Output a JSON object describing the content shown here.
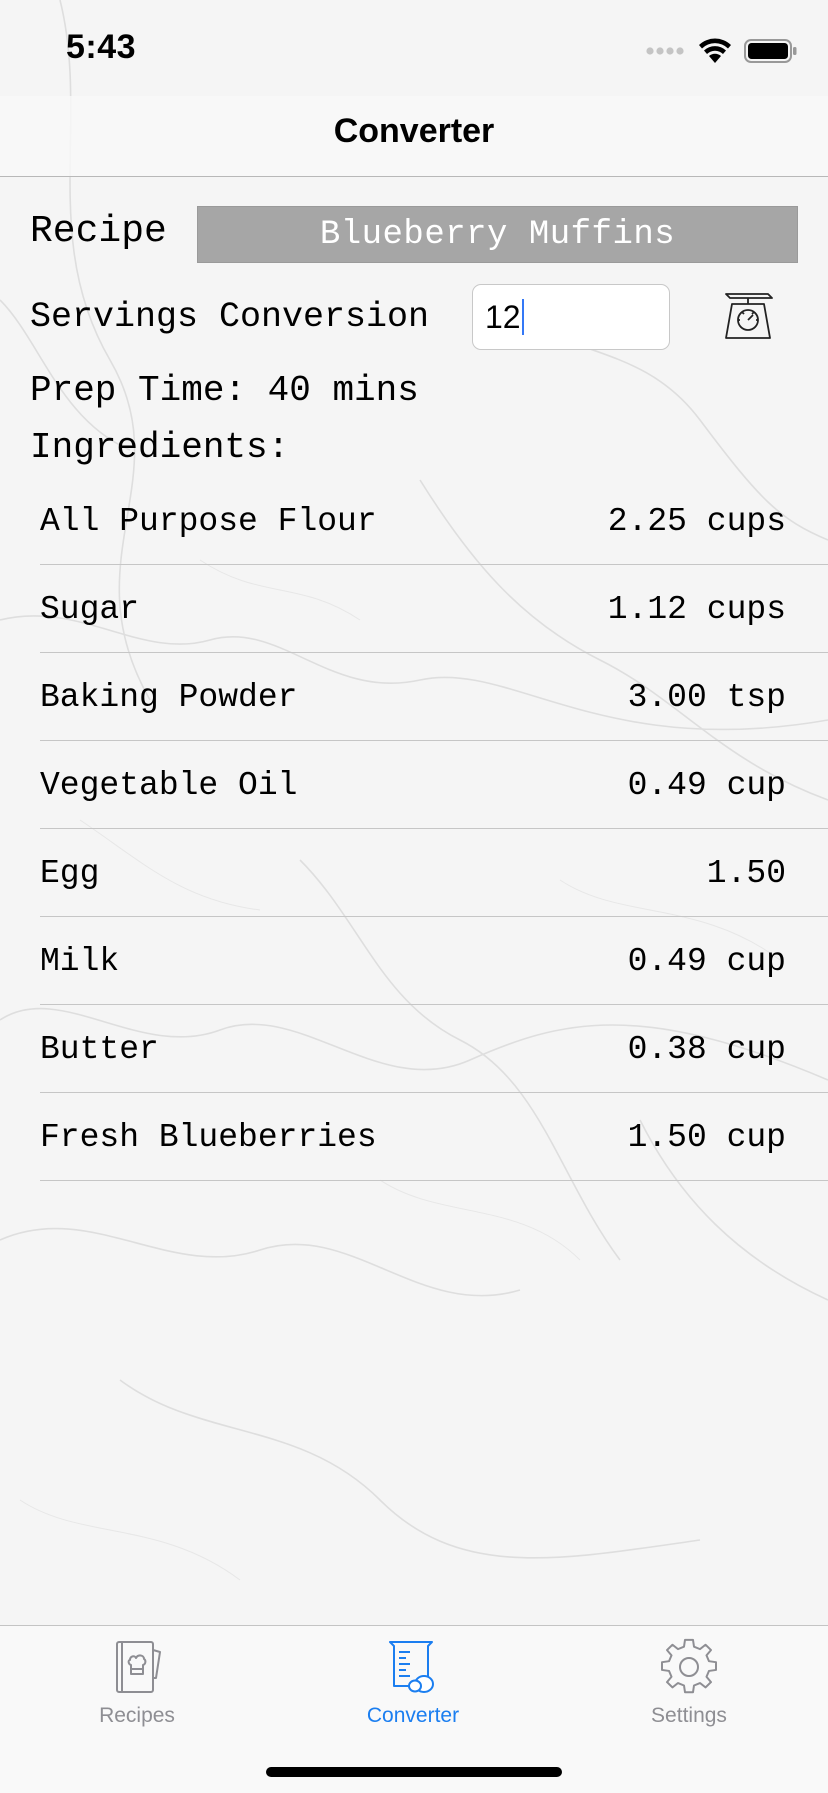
{
  "status_bar": {
    "time": "5:43"
  },
  "nav": {
    "title": "Converter"
  },
  "recipe": {
    "label": "Recipe",
    "selected": "Blueberry Muffins"
  },
  "servings": {
    "label": "Servings Conversion",
    "value": "12"
  },
  "prep_time": "Prep Time: 40 mins",
  "ingredients_heading": "Ingredients:",
  "ingredients": [
    {
      "name": "All Purpose Flour",
      "qty": "2.25 cups"
    },
    {
      "name": "Sugar",
      "qty": "1.12 cups"
    },
    {
      "name": "Baking Powder",
      "qty": "3.00 tsp"
    },
    {
      "name": "Vegetable Oil",
      "qty": "0.49 cup"
    },
    {
      "name": "Egg",
      "qty": "1.50"
    },
    {
      "name": "Milk",
      "qty": "0.49 cup"
    },
    {
      "name": "Butter",
      "qty": "0.38 cup"
    },
    {
      "name": "Fresh Blueberries",
      "qty": "1.50 cup"
    }
  ],
  "tabs": [
    {
      "label": "Recipes",
      "icon": "recipe-book-icon",
      "active": false
    },
    {
      "label": "Converter",
      "icon": "measuring-cup-icon",
      "active": true
    },
    {
      "label": "Settings",
      "icon": "gear-icon",
      "active": false
    }
  ],
  "colors": {
    "accent": "#1b7ef0",
    "inactive_tab": "#8e8e93",
    "recipe_selector_bg": "#a6a6a6"
  }
}
